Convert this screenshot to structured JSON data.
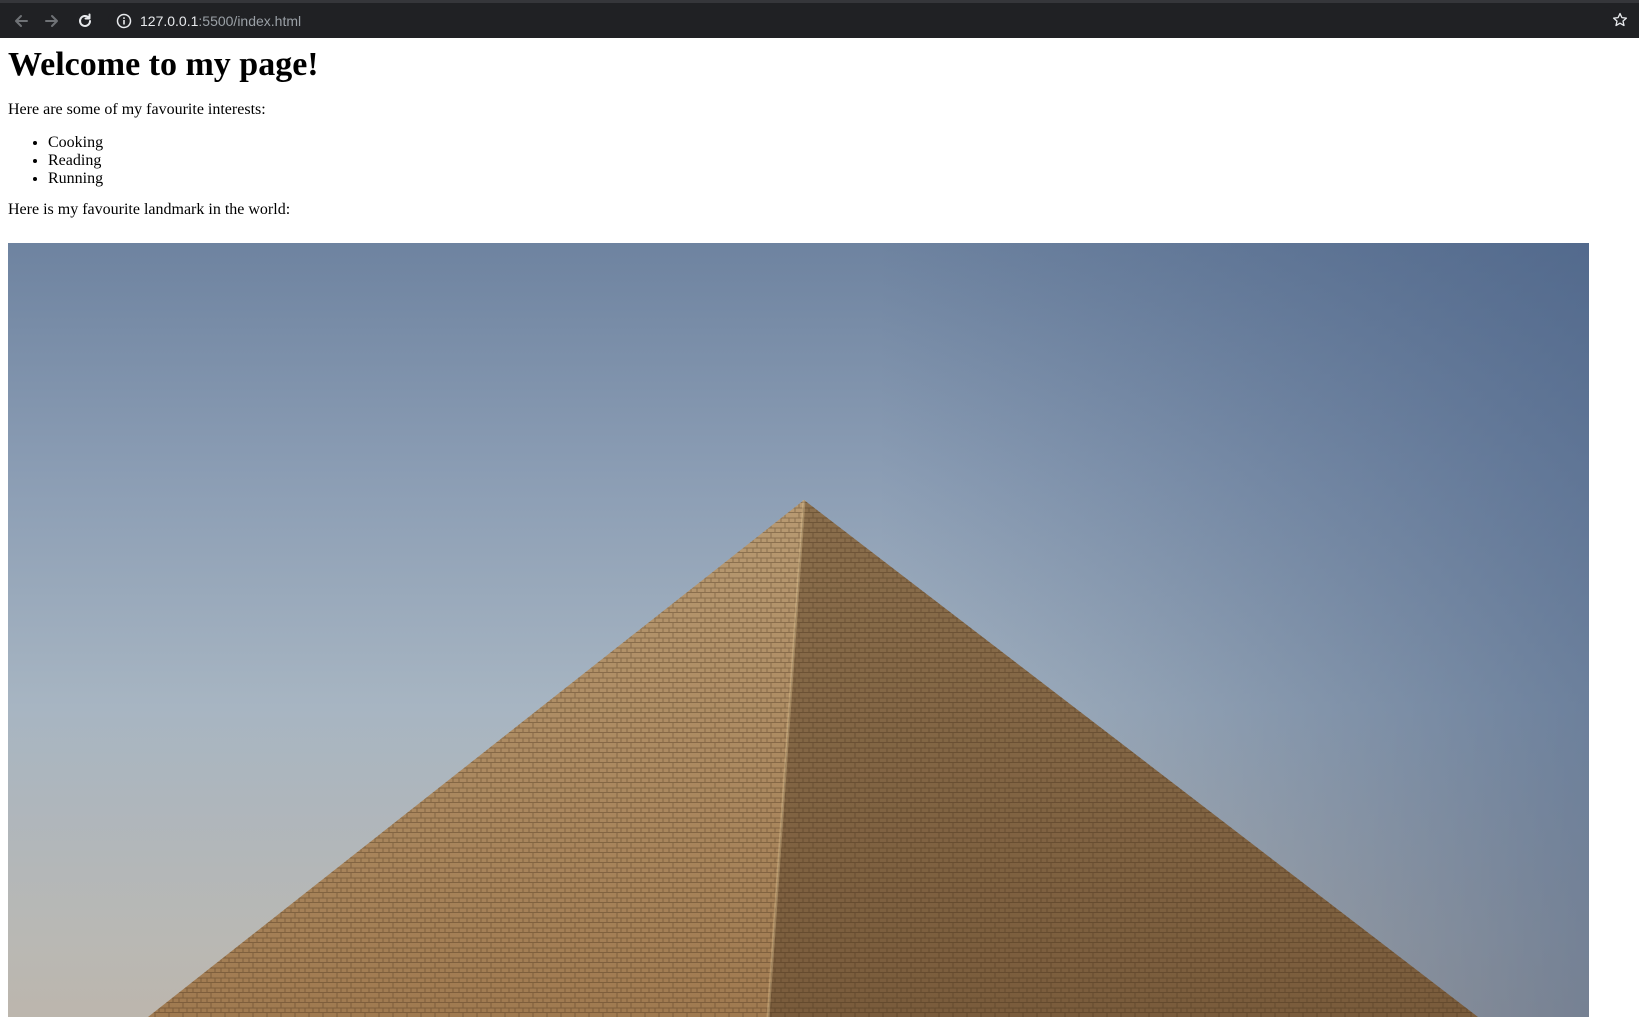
{
  "browser": {
    "url_host": "127.0.0.1",
    "url_path": ":5500/index.html",
    "icons": [
      "back-icon",
      "forward-icon",
      "reload-icon",
      "info-icon",
      "star-icon"
    ]
  },
  "page": {
    "heading": "Welcome to my page!",
    "intro": "Here are some of my favourite interests:",
    "interests": [
      "Cooking",
      "Reading",
      "Running"
    ],
    "landmark_text": "Here is my favourite landmark in the world:"
  },
  "colors": {
    "toolbar": "#202124",
    "url_host": "#e8eaed",
    "url_path": "#9aa0a6",
    "sky_top": "#6e83a0",
    "stone": "#a8875a"
  }
}
